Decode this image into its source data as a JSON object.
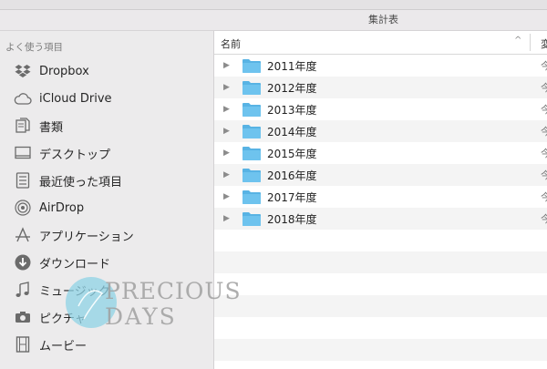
{
  "window": {
    "title": "集計表"
  },
  "sidebar": {
    "heading": "よく使う項目",
    "items": [
      {
        "label": "Dropbox",
        "icon": "dropbox-icon"
      },
      {
        "label": "iCloud Drive",
        "icon": "cloud-icon"
      },
      {
        "label": "書類",
        "icon": "documents-icon"
      },
      {
        "label": "デスクトップ",
        "icon": "desktop-icon"
      },
      {
        "label": "最近使った項目",
        "icon": "recent-items-icon"
      },
      {
        "label": "AirDrop",
        "icon": "airdrop-icon"
      },
      {
        "label": "アプリケーション",
        "icon": "applications-icon"
      },
      {
        "label": "ダウンロード",
        "icon": "downloads-icon"
      },
      {
        "label": "ミュージック",
        "icon": "music-icon"
      },
      {
        "label": "ピクチャ",
        "icon": "camera-icon"
      },
      {
        "label": "ムービー",
        "icon": "film-icon"
      }
    ]
  },
  "list": {
    "column_name": "名前",
    "sort_indicator": "^",
    "next_column": "変",
    "rows": [
      {
        "name": "2011年度",
        "date": "今"
      },
      {
        "name": "2012年度",
        "date": "今"
      },
      {
        "name": "2013年度",
        "date": "今"
      },
      {
        "name": "2014年度",
        "date": "今"
      },
      {
        "name": "2015年度",
        "date": "今"
      },
      {
        "name": "2016年度",
        "date": "今"
      },
      {
        "name": "2017年度",
        "date": "今"
      },
      {
        "name": "2018年度",
        "date": "今"
      }
    ]
  },
  "watermark": {
    "line1": "PRECIOUS",
    "line2": "DAYS"
  },
  "colors": {
    "folder": "#6ec3ee",
    "folder_tab": "#58b3e4",
    "sidebar_bg": "#ecebec",
    "watermark": "#8fd3e6"
  }
}
